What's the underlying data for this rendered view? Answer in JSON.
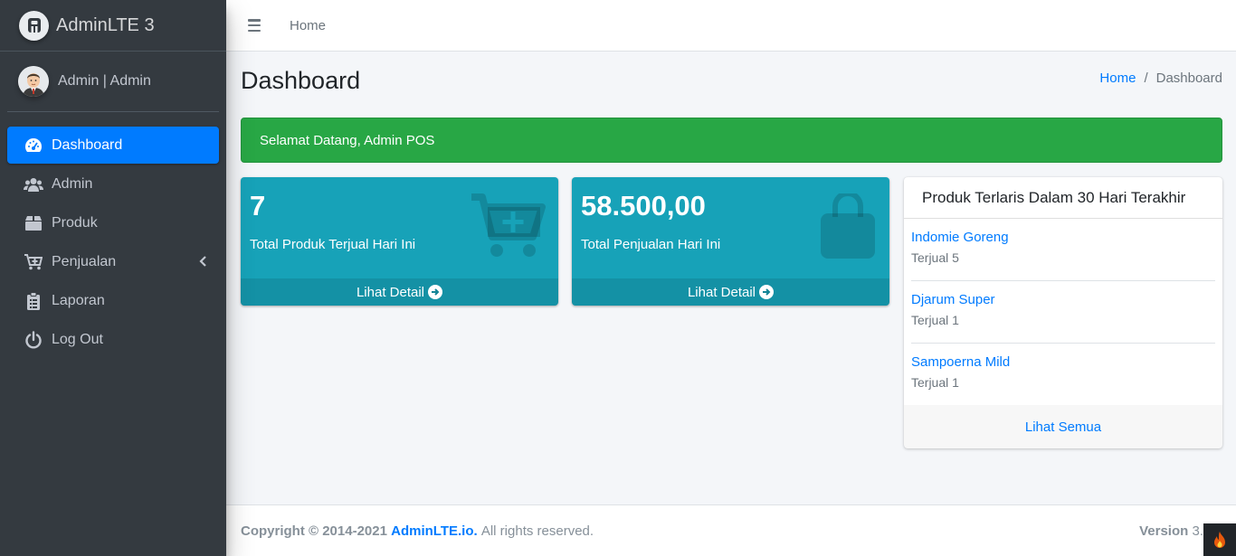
{
  "brand": {
    "name": "AdminLTE 3"
  },
  "user": {
    "name": "Admin | Admin"
  },
  "sidebar": {
    "items": [
      {
        "label": "Dashboard",
        "icon": "tachometer-icon"
      },
      {
        "label": "Admin",
        "icon": "users-icon"
      },
      {
        "label": "Produk",
        "icon": "box-icon"
      },
      {
        "label": "Penjualan",
        "icon": "cart-plus-icon"
      },
      {
        "label": "Laporan",
        "icon": "clipboard-icon"
      },
      {
        "label": "Log Out",
        "icon": "power-icon"
      }
    ]
  },
  "navbar": {
    "home": "Home"
  },
  "header": {
    "title": "Dashboard",
    "breadcrumb": {
      "home": "Home",
      "sep": "/",
      "current": "Dashboard"
    }
  },
  "alert": {
    "text": "Selamat Datang, Admin POS"
  },
  "stats": [
    {
      "value": "7",
      "label": "Total Produk Terjual Hari Ini",
      "footer": "Lihat Detail",
      "icon": "cart-plus-icon"
    },
    {
      "value": "58.500,00",
      "label": "Total Penjualan Hari Ini",
      "footer": "Lihat Detail",
      "icon": "shopping-bag-icon"
    }
  ],
  "bestsellers": {
    "title": "Produk Terlaris Dalam 30 Hari Terakhir",
    "items": [
      {
        "name": "Indomie Goreng",
        "sold": "Terjual 5"
      },
      {
        "name": "Djarum Super",
        "sold": "Terjual 1"
      },
      {
        "name": "Sampoerna Mild",
        "sold": "Terjual 1"
      }
    ],
    "footer": "Lihat Semua"
  },
  "footer": {
    "copyright": "Copyright © 2014-2021",
    "link": "AdminLTE.io.",
    "rights": "All rights reserved.",
    "version_label": "Version",
    "version_value": "3."
  },
  "colors": {
    "primary": "#007bff",
    "success": "#28a745",
    "info": "#17a2b8",
    "sidebar": "#343a40"
  }
}
